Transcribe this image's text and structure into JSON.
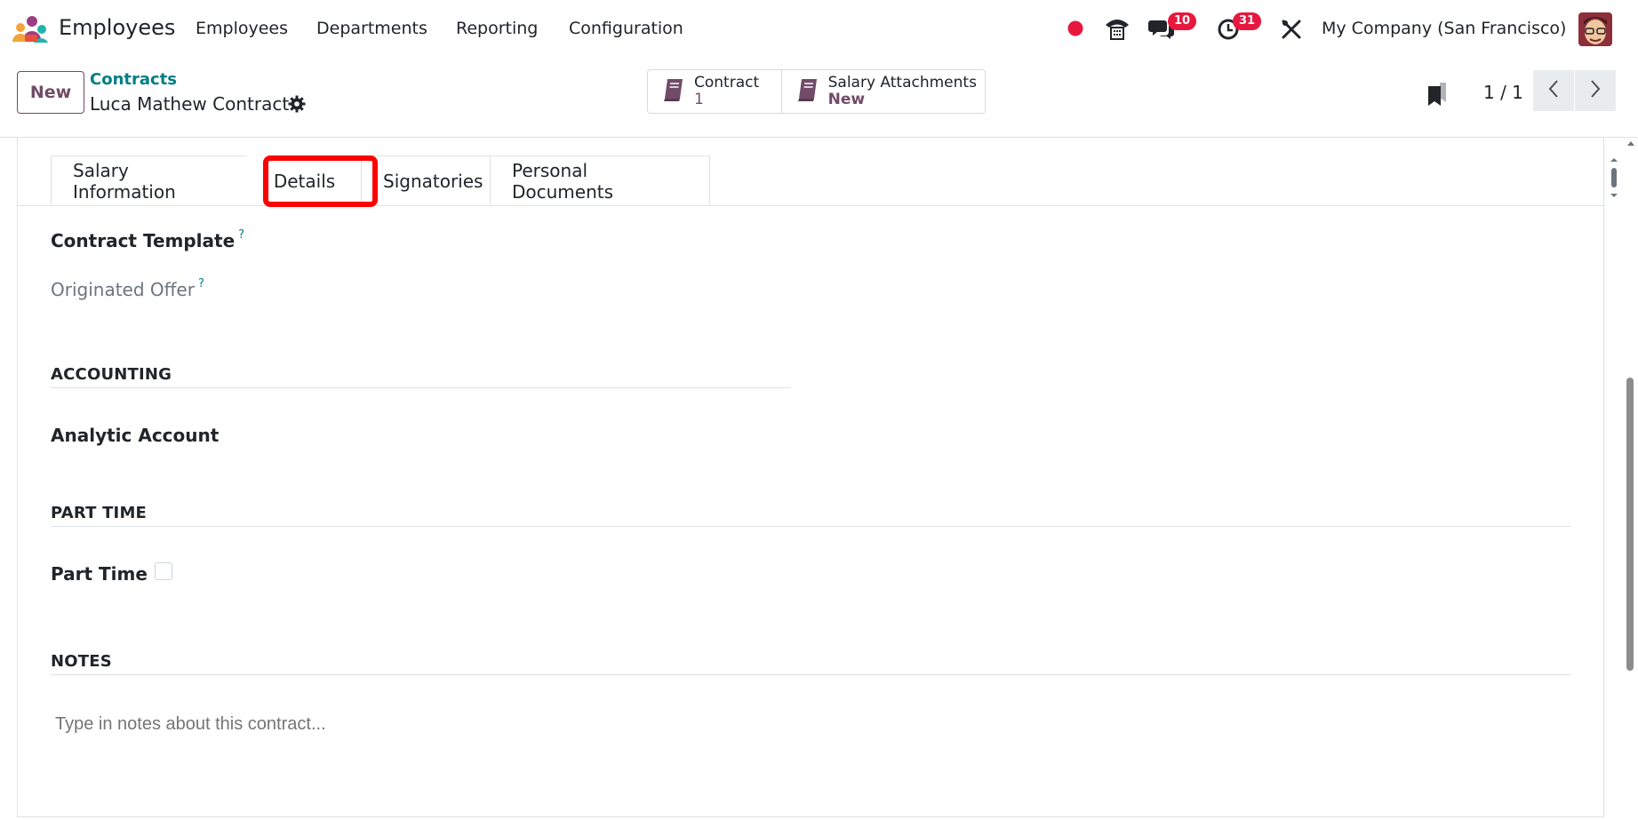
{
  "navbar": {
    "app_title": "Employees",
    "menu": [
      "Employees",
      "Departments",
      "Reporting",
      "Configuration"
    ],
    "chat_badge": "10",
    "activity_badge": "31",
    "company": "My Company (San Francisco)"
  },
  "control": {
    "new_label": "New",
    "breadcrumb_parent": "Contracts",
    "breadcrumb_current": "Luca Mathew Contract",
    "stat_buttons": [
      {
        "title": "Contract",
        "value": "1"
      },
      {
        "title": "Salary Attachments",
        "value": "New"
      }
    ],
    "pager": "1 / 1"
  },
  "tabs": [
    "Salary Information",
    "Details",
    "Signatories",
    "Personal Documents"
  ],
  "details": {
    "contract_template_label": "Contract Template",
    "originated_offer_label": "Originated Offer",
    "help_mark": "?",
    "accounting_title": "ACCOUNTING",
    "analytic_account_label": "Analytic Account",
    "part_time_title": "PART TIME",
    "part_time_label": "Part Time",
    "part_time_checked": false,
    "notes_title": "NOTES",
    "notes_placeholder": "Type in notes about this contract..."
  },
  "colors": {
    "brand": "#714b67",
    "link": "#017e84",
    "badge": "#e8173e",
    "highlight": "#ff0000"
  }
}
